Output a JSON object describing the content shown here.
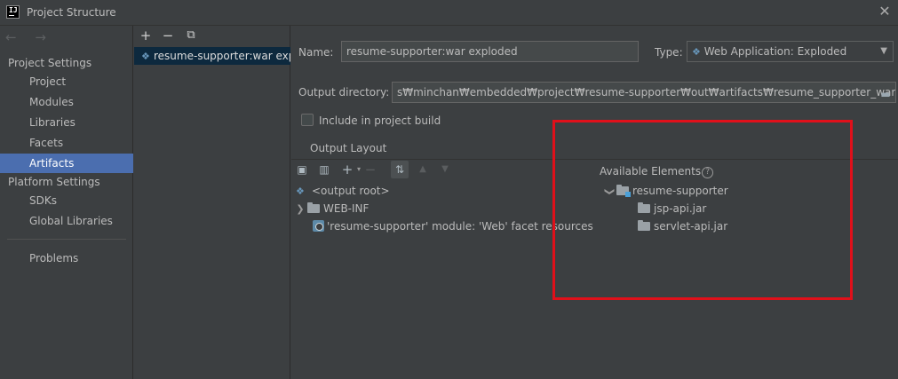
{
  "window": {
    "title": "Project Structure",
    "close_glyph": "✕",
    "logo_text": "IJ"
  },
  "nav": {
    "arrows": "← →",
    "sections": {
      "project_settings": "Project Settings",
      "platform_settings": "Platform Settings"
    },
    "project_items": [
      "Project",
      "Modules",
      "Libraries",
      "Facets",
      "Artifacts"
    ],
    "platform_items": [
      "SDKs",
      "Global Libraries"
    ],
    "problems": "Problems",
    "selected": "Artifacts"
  },
  "artifacts": {
    "toolbar": {
      "add": "+",
      "remove": "−",
      "copy": "⧉"
    },
    "items": [
      "resume-supporter:war exploded"
    ]
  },
  "form": {
    "name_label": "Name:",
    "name_value": "resume-supporter:war exploded",
    "type_label": "Type:",
    "type_value": "Web Application: Exploded",
    "output_dir_label": "Output directory:",
    "output_dir_value": "s₩minchan₩embedded₩project₩resume-supporter₩out₩artifacts₩resume_supporter_war_exploded",
    "include_label": "Include in project build",
    "include_checked": false
  },
  "output_layout": {
    "tab_label": "Output Layout",
    "tree": {
      "root": "<output root>",
      "web_inf": "WEB-INF",
      "facet_resources": "'resume-supporter' module: 'Web' facet resources"
    }
  },
  "available_elements": {
    "title": "Available Elements",
    "help": "?",
    "module": "resume-supporter",
    "jars": [
      "jsp-api.jar",
      "servlet-api.jar"
    ]
  },
  "colors": {
    "selection": "#4b6eaf",
    "highlight_box": "#e0101a",
    "background": "#3c3f41"
  }
}
